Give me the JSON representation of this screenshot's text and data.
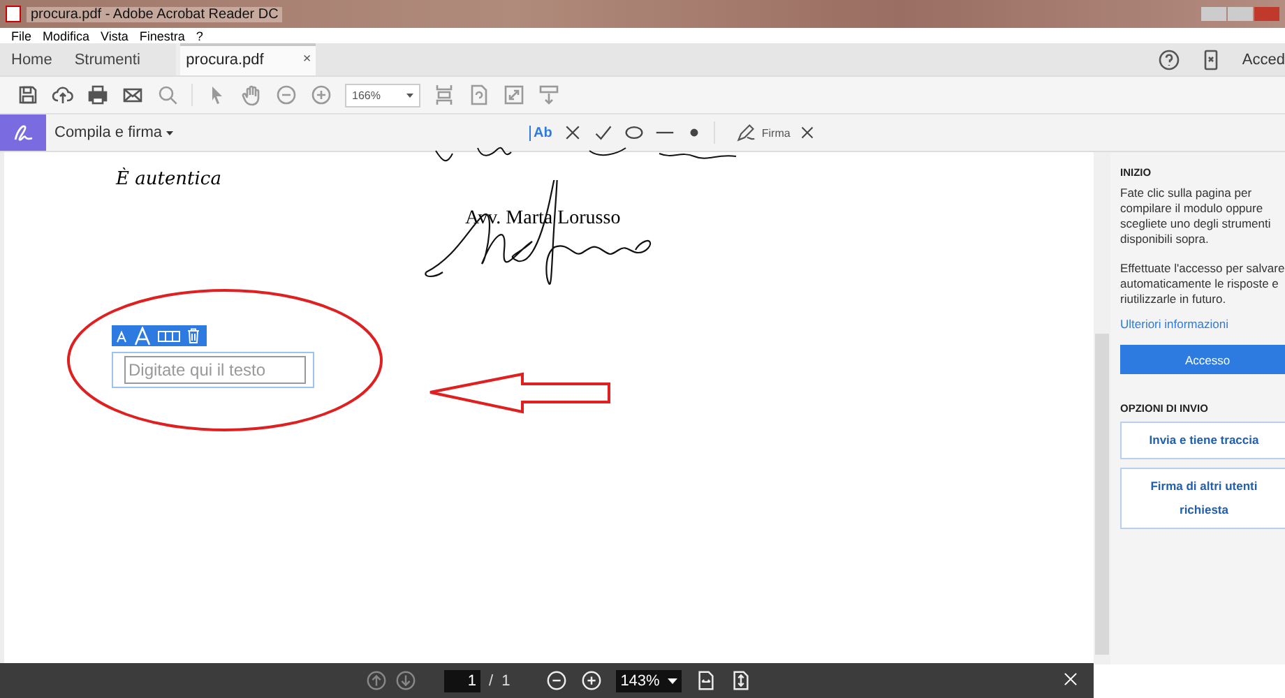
{
  "window": {
    "title": "procura.pdf - Adobe Acrobat Reader DC"
  },
  "menu": [
    "File",
    "Modifica",
    "Vista",
    "Finestra",
    "?"
  ],
  "tabs": [
    {
      "label": "Home",
      "kind": "nav",
      "selected": false
    },
    {
      "label": "Strumenti",
      "kind": "nav",
      "selected": false
    },
    {
      "label": "procura.pdf",
      "kind": "document",
      "selected": true,
      "close": "×"
    }
  ],
  "account": {
    "label": "Acced"
  },
  "toolbar": {
    "zoom": "166%"
  },
  "fill_sign": {
    "title": "Compila e firma",
    "add_text_label": "Ab",
    "sign_label": "Firma"
  },
  "document": {
    "note": "È autentica",
    "signer": "Avv. Marta Lorusso",
    "text_field": {
      "placeholder": "Digitate qui il testo"
    }
  },
  "panel": {
    "heading": "INIZIO",
    "intro": "Fate clic sulla pagina per compilare il modulo oppure scegliete uno degli strumenti disponibili sopra.",
    "login_note": "Effettuate l'accesso per salvare automaticamente le risposte e riutilizzarle in futuro.",
    "link": "Ulteriori informazioni",
    "login_button": "Accesso",
    "send_heading": "OPZIONI DI INVIO",
    "send_buttons": [
      "Invia e tiene traccia",
      "Firma di altri utenti richiesta"
    ]
  },
  "bottom_bar": {
    "page_current": "1",
    "page_separator": "/",
    "page_total": "1",
    "zoom": "143%"
  }
}
